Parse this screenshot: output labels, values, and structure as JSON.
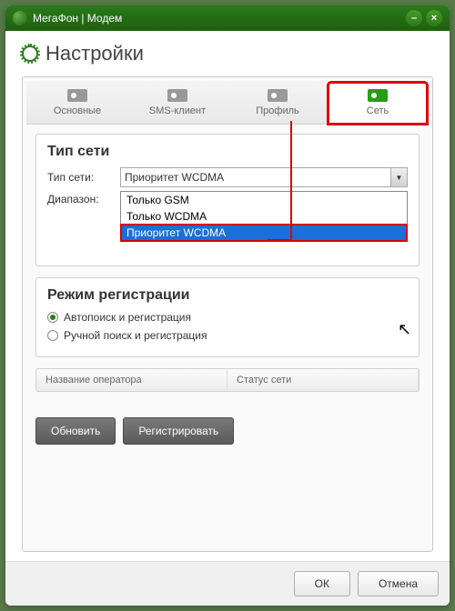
{
  "window": {
    "title": "МегаФон | Модем"
  },
  "page": {
    "title": "Настройки"
  },
  "tabs": {
    "basic": "Основные",
    "sms": "SMS-клиент",
    "profile": "Профиль",
    "network": "Сеть"
  },
  "network_type": {
    "heading": "Тип сети",
    "type_label": "Тип сети:",
    "range_label": "Диапазон:",
    "selected": "Приоритет WCDMA",
    "options": {
      "gsm_only": "Только GSM",
      "wcdma_only": "Только WCDMA",
      "wcdma_priority": "Приоритет WCDMA"
    }
  },
  "registration": {
    "heading": "Режим регистрации",
    "auto": "Автопоиск и регистрация",
    "manual": "Ручной поиск и регистрация"
  },
  "table": {
    "col_operator": "Название оператора",
    "col_status": "Статус сети"
  },
  "buttons": {
    "refresh": "Обновить",
    "register": "Регистрировать",
    "ok": "ОК",
    "cancel": "Отмена"
  }
}
